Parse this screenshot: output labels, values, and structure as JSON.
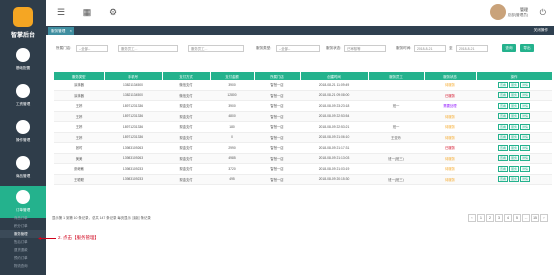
{
  "brand": {
    "logo_text": "智掌后台"
  },
  "sidebar": {
    "items": [
      {
        "label": "基础配置"
      },
      {
        "label": "工资管理"
      },
      {
        "label": "操作管理"
      },
      {
        "label": "商品管理"
      },
      {
        "label": "订单管理"
      }
    ],
    "sub_items": [
      {
        "label": "商品订单"
      },
      {
        "label": "积分订单"
      },
      {
        "label": "服务管理"
      },
      {
        "label": "售后订单"
      },
      {
        "label": "退货退款"
      },
      {
        "label": "预约订单"
      },
      {
        "label": "物流查询"
      },
      {
        "label": "订单评价"
      },
      {
        "label": "售后管理"
      }
    ]
  },
  "topbar": {
    "user_name": "管理",
    "user_role": "总部(管理员)"
  },
  "tabs": [
    {
      "label": "服务管理"
    }
  ],
  "tabbar": {
    "close_ops": "关闭操作"
  },
  "filters": {
    "store_label": "所属门店:",
    "store_value": "--全部--",
    "service_label": "服务类型",
    "service_placeholder": "服务员工...",
    "emp_placeholder": "服务员工...",
    "pay_label": "服务类型:",
    "pay_value": "--全部--",
    "status_label": "服务状态:",
    "status_value": "已审核等",
    "date_label": "服务时间:",
    "date_from": "2018-8-21",
    "date_sep": "至",
    "date_to": "2018-8-21",
    "search_btn": "查询",
    "export_btn": "导出"
  },
  "table": {
    "headers": [
      "服务类型",
      "手机号",
      "支付方式",
      "支付金额",
      "所属门店",
      "创建时间",
      "服务员工",
      "服务状态",
      "操作"
    ],
    "rows": [
      [
        "涂抹器",
        "13821134500",
        "微信支付",
        "3900",
        "智慧一店",
        "2018-08-21 11:09:49",
        "",
        "待服务",
        ""
      ],
      [
        "涂抹器",
        "13821134500",
        "微信支付",
        "12800",
        "智慧一店",
        "2018-08-21 09:08:00",
        "",
        "已服务",
        ""
      ],
      [
        "王婷",
        "18971231336",
        "现金支付",
        "3900",
        "智慧一店",
        "2018-08-09 23:23:18",
        "班一",
        "需要处理",
        ""
      ],
      [
        "王婷",
        "18971231336",
        "现金支付",
        "4800",
        "智慧一店",
        "2018-08-09 22:53:54",
        "",
        "待服务",
        ""
      ],
      [
        "王婷",
        "18971231336",
        "现金支付",
        "180",
        "智慧一店",
        "2018-08-09 22:53:21",
        "班一",
        "待服务",
        ""
      ],
      [
        "王婷",
        "18971231336",
        "现金支付",
        "0",
        "智慧一店",
        "2018-08-09 21:06:10",
        "王亚玲",
        "待服务",
        ""
      ],
      [
        "张时",
        "13983109263",
        "现金支付",
        "2990",
        "智慧一店",
        "2018-08-09 21:17:31",
        "",
        "已服务",
        ""
      ],
      [
        "美美",
        "13983109263",
        "现金支付",
        "4985",
        "智慧一店",
        "2018-08-09 21:13:03",
        "班一(班三)",
        "待服务",
        ""
      ],
      [
        "张继敏",
        "13983109233",
        "现金支付",
        "3720",
        "智慧一店",
        "2018-08-09 21:03:19",
        "",
        "待服务",
        ""
      ],
      [
        "王聪聪",
        "13983109233",
        "现金支付",
        "495",
        "智慧一店",
        "2018-08-09 20:15:30",
        "班一(班三)",
        "待服务",
        ""
      ]
    ],
    "ops": [
      "查看",
      "服务",
      "详情"
    ]
  },
  "footer": {
    "info": "显示第 1 到第 10 条记录，总共 147 条记录 每页显示",
    "page_size": "10",
    "suffix": "条记录",
    "pages": [
      "‹",
      "1",
      "2",
      "3",
      "4",
      "5",
      "...",
      "15",
      "›"
    ]
  },
  "annotation": {
    "text": "2. 点击【服务管理】"
  },
  "colors": {
    "accent": "#24b28d",
    "sidebar": "#2f3d4a",
    "annot": "#d0021b",
    "status_pending": "#f5a623",
    "status_done": "#d0021b"
  }
}
